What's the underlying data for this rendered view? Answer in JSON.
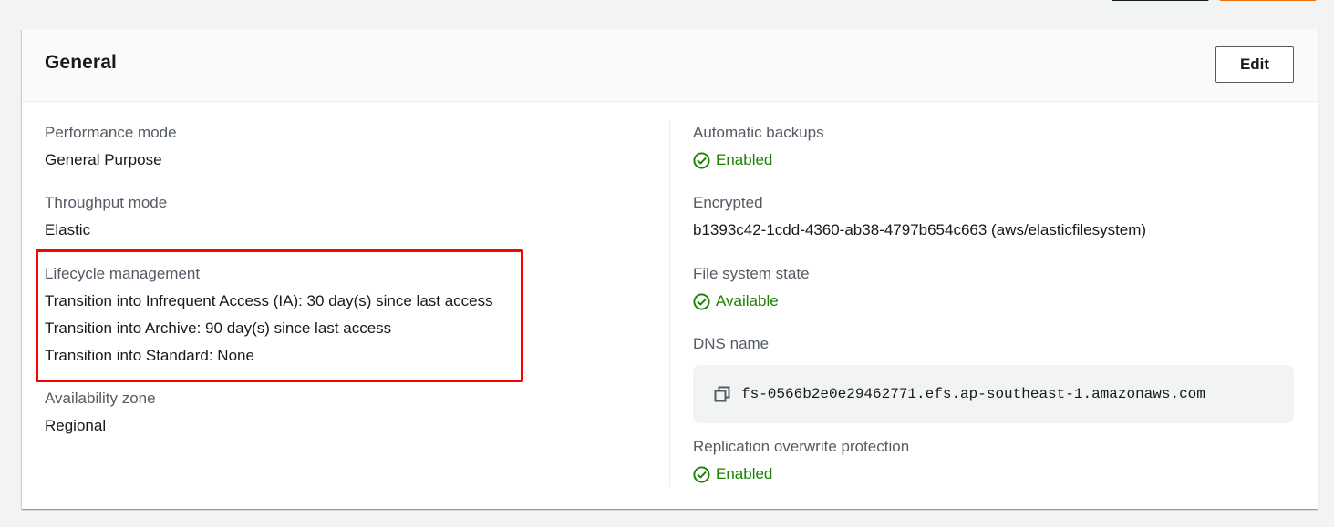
{
  "panel": {
    "title": "General",
    "edit_label": "Edit"
  },
  "left": {
    "performance_mode": {
      "label": "Performance mode",
      "value": "General Purpose"
    },
    "throughput_mode": {
      "label": "Throughput mode",
      "value": "Elastic"
    },
    "lifecycle": {
      "label": "Lifecycle management",
      "lines": [
        "Transition into Infrequent Access (IA): 30 day(s) since last access",
        "Transition into Archive: 90 day(s) since last access",
        "Transition into Standard: None"
      ]
    },
    "availability_zone": {
      "label": "Availability zone",
      "value": "Regional"
    }
  },
  "right": {
    "automatic_backups": {
      "label": "Automatic backups",
      "value": "Enabled"
    },
    "encrypted": {
      "label": "Encrypted",
      "value": "b1393c42-1cdd-4360-ab38-4797b654c663 (aws/elasticfilesystem)"
    },
    "file_system_state": {
      "label": "File system state",
      "value": "Available"
    },
    "dns_name": {
      "label": "DNS name",
      "value": "fs-0566b2e0e29462771.efs.ap-southeast-1.amazonaws.com"
    },
    "replication_overwrite": {
      "label": "Replication overwrite protection",
      "value": "Enabled"
    }
  },
  "colors": {
    "success": "#1d8102",
    "highlight": "#ff0000",
    "label": "#545b64",
    "text": "#16191f"
  },
  "icons": {
    "status": "check-circle-icon",
    "copy": "copy-icon"
  }
}
